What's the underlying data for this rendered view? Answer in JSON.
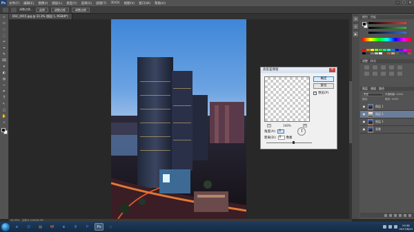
{
  "app": {
    "logo": "Ps"
  },
  "menu": {
    "items": [
      "文件(F)",
      "编辑(E)",
      "图像(I)",
      "图层(L)",
      "类型(Y)",
      "选择(S)",
      "滤镜(T)",
      "3D(D)",
      "视图(V)",
      "窗口(W)",
      "帮助(H)"
    ]
  },
  "window_controls": [
    "–",
    "□",
    "✕"
  ],
  "options_bar": {
    "mode_label": "调整边缘...",
    "btn1": "选择",
    "btn2": "调整边缘",
    "btn3": "调整边缘"
  },
  "document_tabs": [
    {
      "label": "DSC_0015.jpg @ 33.3% (图层 1, RGB/8*)",
      "active": true
    }
  ],
  "tools": [
    "⊹",
    "▭",
    "◌",
    "⬚",
    "✂",
    "⌖",
    "✎",
    "⌧",
    "✦",
    "◐",
    "◍",
    "⌁",
    "✒",
    "T",
    "↖",
    "▢",
    "✋",
    "⌕"
  ],
  "status": {
    "zoom": "33.33%",
    "doc": "文档:9.11M/18.2M"
  },
  "dialog": {
    "title": "高反差保留",
    "close": "✕",
    "ok": "确定",
    "cancel": "复位",
    "preview_label": "预览(P)",
    "preview_checked": "✓",
    "zoom_minus": "−",
    "zoom_plus": "+",
    "zoom_value": "100%",
    "angle_label": "角度(A):",
    "angle_value": "0",
    "distance_label": "距离(D):",
    "distance_value": "0",
    "unit": "像素",
    "slider_value": 0.6
  },
  "color_panel": {
    "tabs": [
      "颜色",
      "色板"
    ],
    "slider_colors": [
      "#e0413a",
      "#3fae4a",
      "#3b6fe0"
    ]
  },
  "swatches": {
    "colors": [
      "#ff0000",
      "#ff8000",
      "#ffff00",
      "#80ff00",
      "#00ff00",
      "#00ff80",
      "#00ffff",
      "#0080ff",
      "#0000ff",
      "#8000ff",
      "#ff00ff",
      "#ff0080",
      "#000000",
      "#404040",
      "#808080",
      "#c0c0c0",
      "#ffffff",
      "#8b4513",
      "#c06030",
      "#e0a070",
      "#507030",
      "#305070",
      "#603080",
      "#a05050"
    ]
  },
  "adjustments": {
    "tabs": [
      "调整",
      "样式"
    ]
  },
  "layers": {
    "tabs": [
      "图层",
      "通道",
      "路径"
    ],
    "kind_select": "类型",
    "opacity_label": "不透明度: 100%",
    "fill_label": "填充: 100%",
    "lock_label": "锁定:",
    "rows": [
      {
        "name": "图层 1",
        "visible": "●",
        "thumb": "photo2",
        "selected": false
      },
      {
        "name": "图层 1",
        "visible": "●",
        "thumb": "bw",
        "selected": true
      },
      {
        "name": "图层 1",
        "visible": "●",
        "thumb": "photo2",
        "selected": false
      },
      {
        "name": "背景",
        "visible": "●",
        "thumb": "photo2",
        "selected": false
      }
    ]
  },
  "taskbar": {
    "apps": [
      {
        "icon": "e",
        "color": "#2f8fe0",
        "active": false
      },
      {
        "icon": "☺",
        "color": "#1aa0e0",
        "active": false
      },
      {
        "icon": "▤",
        "color": "#e0b040",
        "active": false
      },
      {
        "icon": "W",
        "color": "#e05a20",
        "active": false
      },
      {
        "icon": "e",
        "color": "#3aa0e8",
        "active": false
      },
      {
        "icon": "S",
        "color": "#2a8be0",
        "active": false
      },
      {
        "icon": "P",
        "color": "#3a5fb0",
        "active": false
      },
      {
        "icon": "Ps",
        "color": "#1c2f55",
        "active": true
      },
      {
        "icon": "◎",
        "color": "#606060",
        "active": false
      }
    ],
    "time": "19:38",
    "date": "2017/8/24"
  }
}
